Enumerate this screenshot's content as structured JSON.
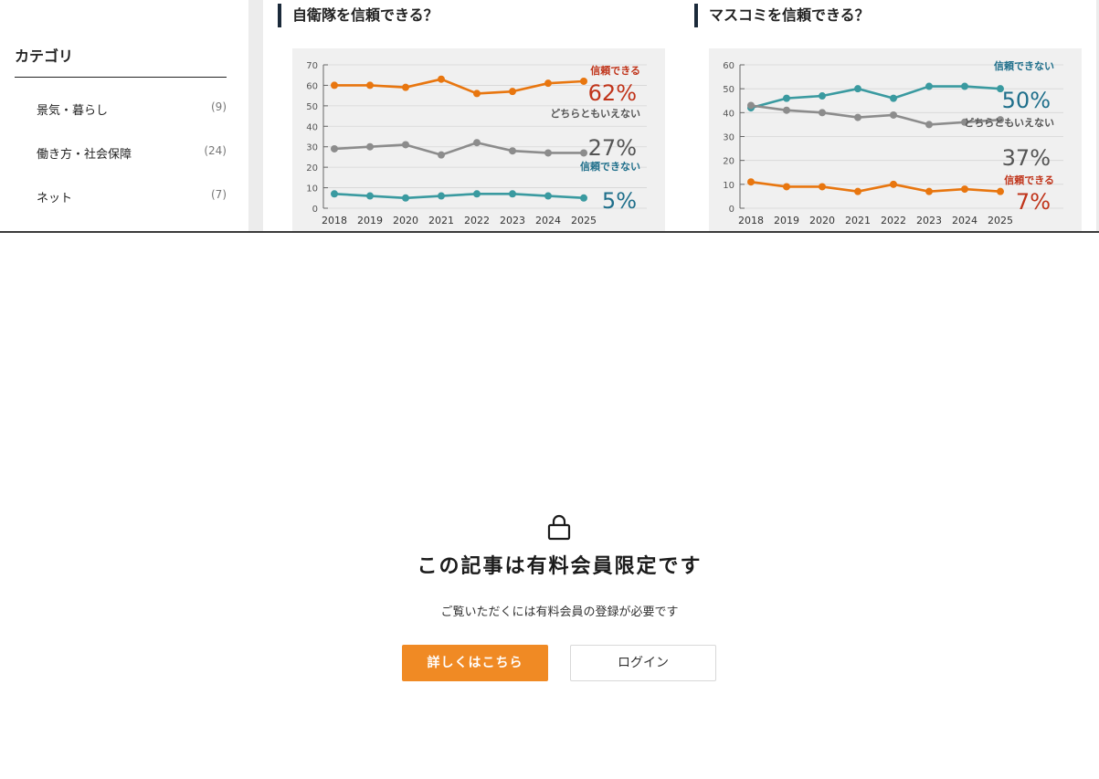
{
  "sidebar": {
    "heading": "カテゴリ",
    "items": [
      {
        "label": "景気・暮らし",
        "count": "(9)"
      },
      {
        "label": "働き方・社会保障",
        "count": "(24)"
      },
      {
        "label": "ネット",
        "count": "(7)"
      }
    ]
  },
  "cards": [
    {
      "title": "自衛隊を信頼できる？"
    },
    {
      "title": "マスコミを信頼できる？"
    }
  ],
  "chart_data": [
    {
      "type": "line",
      "title": "自衛隊を信頼できる？",
      "x": [
        "2018",
        "2019",
        "2020",
        "2021",
        "2022",
        "2023",
        "2024",
        "2025"
      ],
      "ylim": [
        0,
        70
      ],
      "yticks": [
        0,
        10,
        20,
        30,
        40,
        50,
        60,
        70
      ],
      "grid": true,
      "series": [
        {
          "name": "信頼できる",
          "color": "#e8760f",
          "values": [
            60,
            60,
            59,
            63,
            56,
            57,
            61,
            62
          ],
          "end_label": "62%",
          "label_color": "#c0341a"
        },
        {
          "name": "どちらともいえない",
          "color": "#8c8c8c",
          "values": [
            29,
            30,
            31,
            26,
            32,
            28,
            27,
            27
          ],
          "end_label": "27%",
          "label_color": "#555555"
        },
        {
          "name": "信頼できない",
          "color": "#3a9aa0",
          "values": [
            7,
            6,
            5,
            6,
            7,
            7,
            6,
            5
          ],
          "end_label": "5%",
          "label_color": "#1f6f8b"
        }
      ]
    },
    {
      "type": "line",
      "title": "マスコミを信頼できる？",
      "x": [
        "2018",
        "2019",
        "2020",
        "2021",
        "2022",
        "2023",
        "2024",
        "2025"
      ],
      "ylim": [
        0,
        60
      ],
      "yticks": [
        0,
        10,
        20,
        30,
        40,
        50,
        60
      ],
      "grid": true,
      "series": [
        {
          "name": "信頼できない",
          "color": "#3a9aa0",
          "values": [
            42,
            46,
            47,
            50,
            46,
            51,
            51,
            50
          ],
          "end_label": "50%",
          "label_color": "#1f6f8b"
        },
        {
          "name": "どちらともいえない",
          "color": "#8c8c8c",
          "values": [
            43,
            41,
            40,
            38,
            39,
            35,
            36,
            37
          ],
          "end_label": "37%",
          "label_color": "#555555"
        },
        {
          "name": "信頼できる",
          "color": "#e8760f",
          "values": [
            11,
            9,
            9,
            7,
            10,
            7,
            8,
            7
          ],
          "end_label": "7%",
          "label_color": "#c0341a"
        }
      ]
    }
  ],
  "paywall": {
    "title": "この記事は有料会員限定です",
    "subtitle": "ご覧いただくには有料会員の登録が必要です",
    "details_button": "詳しくはこちら",
    "login_button": "ログイン"
  }
}
